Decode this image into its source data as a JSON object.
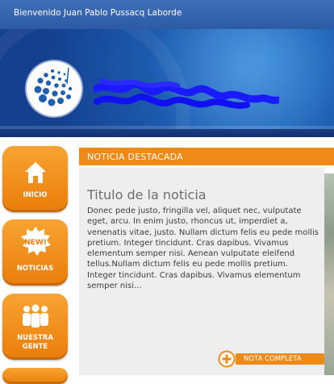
{
  "header": {
    "welcome_text": "Bienvenido Juan Pablo Pussacq Laborde"
  },
  "nav": {
    "items": [
      {
        "label": "INICIO",
        "icon": "home-icon"
      },
      {
        "label": "NOTICIAS",
        "icon": "new-badge-icon",
        "badge": "NEW!"
      },
      {
        "label": "NUESTRA\nGENTE",
        "icon": "people-icon"
      }
    ]
  },
  "featured": {
    "section_title": "NOTICIA DESTACADA",
    "news_title": "Titulo de la noticia",
    "news_body": "Donec pede justo, fringilla vel, aliquet nec, vulputate eget, arcu. In enim justo, rhoncus ut, imperdiet a, venenatis vitae, justo. Nullam dictum felis eu pede mollis pretium. Integer tincidunt. Cras dapibus. Vivamus elementum semper nisi. Aenean vulputate eleifend tellus.Nullam dictum felis eu pede mollis pretium. Integer tincidunt. Cras dapibus. Vivamus elementum semper nisi...",
    "more_label": "NOTA COMPLETA"
  },
  "colors": {
    "accent_orange": "#ee8a17",
    "header_blue": "#2e5aa4"
  }
}
